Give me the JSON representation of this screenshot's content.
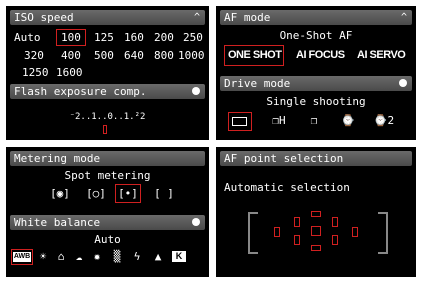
{
  "iso": {
    "title": "ISO speed",
    "toggle": "^",
    "row1": [
      "Auto",
      "100",
      "125",
      "160",
      "200",
      "250"
    ],
    "row2": [
      "320",
      "400",
      "500",
      "640",
      "800",
      "1000"
    ],
    "row3": [
      "1250",
      "1600"
    ],
    "selected": "100"
  },
  "flash": {
    "title": "Flash exposure comp.",
    "scale": "⁻2..1..0..1.²2"
  },
  "af_mode": {
    "title": "AF mode",
    "toggle": "^",
    "current": "One-Shot AF",
    "options": [
      "ONE SHOT",
      "AI FOCUS",
      "AI SERVO"
    ],
    "selected": "ONE SHOT"
  },
  "drive": {
    "title": "Drive mode",
    "current": "Single shooting",
    "icons": [
      "single-shooting-icon",
      "continuous-shooting-icon",
      "burst-icon",
      "self-timer-10s-icon",
      "self-timer-2s-icon"
    ],
    "labels": [
      "☐",
      "❐H",
      "❐",
      "⌚",
      "⌚2"
    ]
  },
  "metering": {
    "title": "Metering mode",
    "current": "Spot metering",
    "icons": [
      "evaluative-metering-icon",
      "partial-metering-icon",
      "spot-metering-icon",
      "center-weighted-icon"
    ],
    "labels": [
      "[◉]",
      "[○]",
      "[•]",
      "[  ]"
    ]
  },
  "wb": {
    "title": "White balance",
    "current": "Auto",
    "icons": [
      "awb-icon",
      "daylight-icon",
      "shade-icon",
      "cloudy-icon",
      "tungsten-icon",
      "fluorescent-icon",
      "flash-icon",
      "custom-wb-icon",
      "kelvin-icon"
    ],
    "labels": [
      "AWB",
      "☀",
      "⌂",
      "☁",
      "✹",
      "▒",
      "ϟ",
      "▲",
      "K"
    ]
  },
  "afpoint": {
    "title": "AF point selection",
    "current": "Automatic selection"
  }
}
